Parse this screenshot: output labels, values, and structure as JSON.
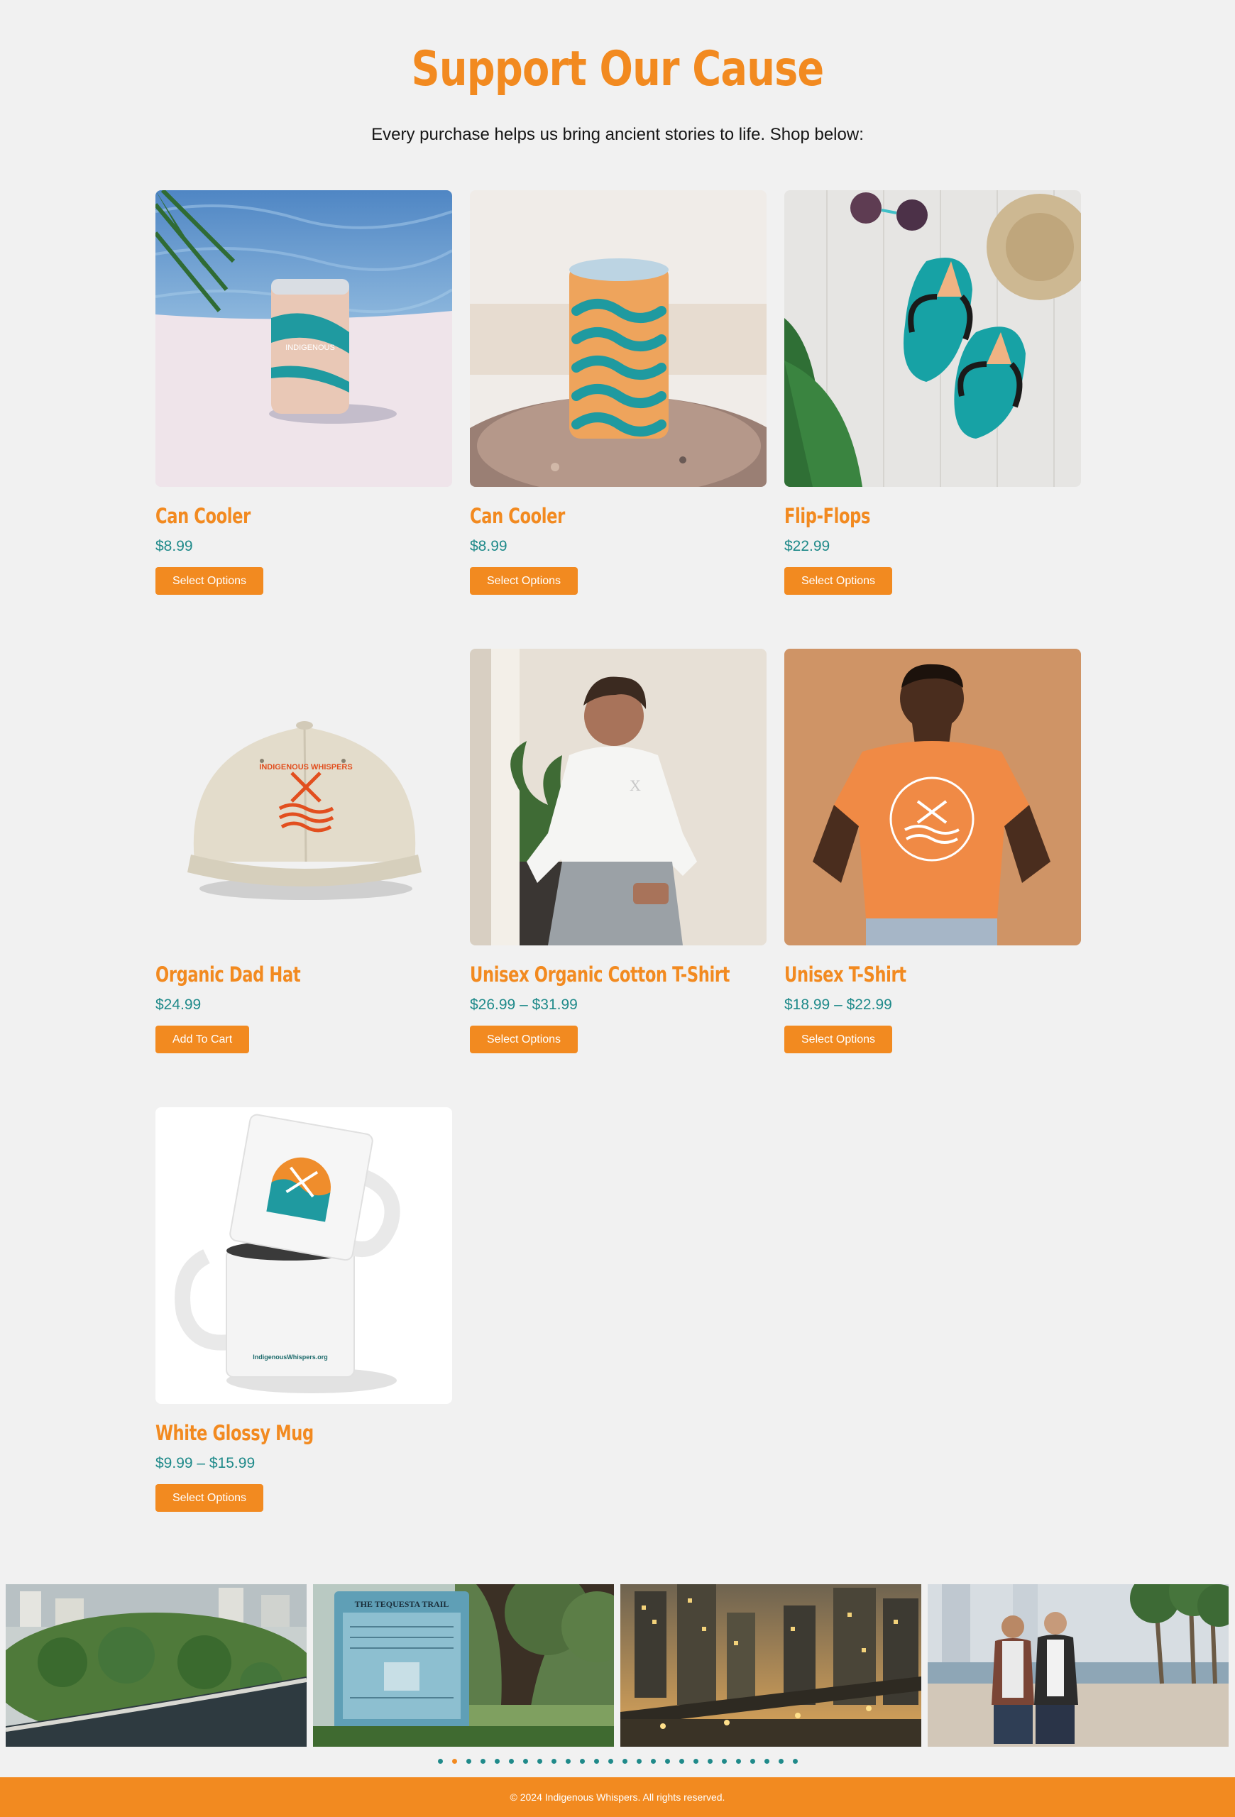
{
  "header": {
    "title": "Support Our Cause",
    "subtitle": "Every purchase helps us bring ancient stories to life. Shop below:"
  },
  "products": [
    {
      "name": "Can Cooler",
      "price": "$8.99",
      "button": "Select Options"
    },
    {
      "name": "Can Cooler",
      "price": "$8.99",
      "button": "Select Options"
    },
    {
      "name": "Flip-Flops",
      "price": "$22.99",
      "button": "Select Options"
    },
    {
      "name": "Organic Dad Hat",
      "price": "$24.99",
      "button": "Add To Cart"
    },
    {
      "name": "Unisex Organic Cotton T-Shirt",
      "price": "$26.99 – $31.99",
      "button": "Select Options"
    },
    {
      "name": "Unisex T-Shirt",
      "price": "$18.99 – $22.99",
      "button": "Select Options"
    },
    {
      "name": "White Glossy Mug",
      "price": "$9.99 – $15.99",
      "button": "Select Options"
    }
  ],
  "product_images": {
    "hat_logo": "INDIGENOUS WHISPERS",
    "mug_url": "IndigenousWhispers.org",
    "sign_title": "THE TEQUESTA TRAIL",
    "cooler_text": "INDIGENOUS"
  },
  "carousel": {
    "total_dots": 26,
    "active_index": 1
  },
  "footer": {
    "copyright": "© 2024 Indigenous Whispers. All rights reserved."
  },
  "colors": {
    "accent": "#f28a20",
    "price": "#1f8a8a",
    "background": "#f1f1f1"
  }
}
